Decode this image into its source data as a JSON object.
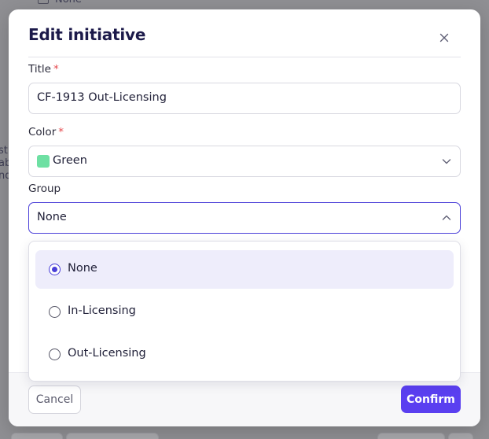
{
  "background": {
    "top_option_label": "None",
    "side_text_lines": [
      "st",
      "ab",
      "nd"
    ]
  },
  "modal": {
    "title": "Edit initiative",
    "close_icon": "close-icon",
    "title_field": {
      "label": "Title",
      "required_marker": "*",
      "value": "CF-1913 Out-Licensing"
    },
    "color_field": {
      "label": "Color",
      "required_marker": "*",
      "value": "Green",
      "swatch_color": "#6ee0a3",
      "chevron_icon": "chevron-down-icon"
    },
    "group_field": {
      "label": "Group",
      "value": "None",
      "chevron_icon": "chevron-up-icon",
      "focus_color": "#4a3fd8",
      "options": [
        {
          "label": "None",
          "selected": true
        },
        {
          "label": "In-Licensing",
          "selected": false
        },
        {
          "label": "Out-Licensing",
          "selected": false
        }
      ]
    },
    "footer": {
      "cancel_label": "Cancel",
      "confirm_label": "Confirm",
      "confirm_color": "#5a3ff0"
    }
  }
}
